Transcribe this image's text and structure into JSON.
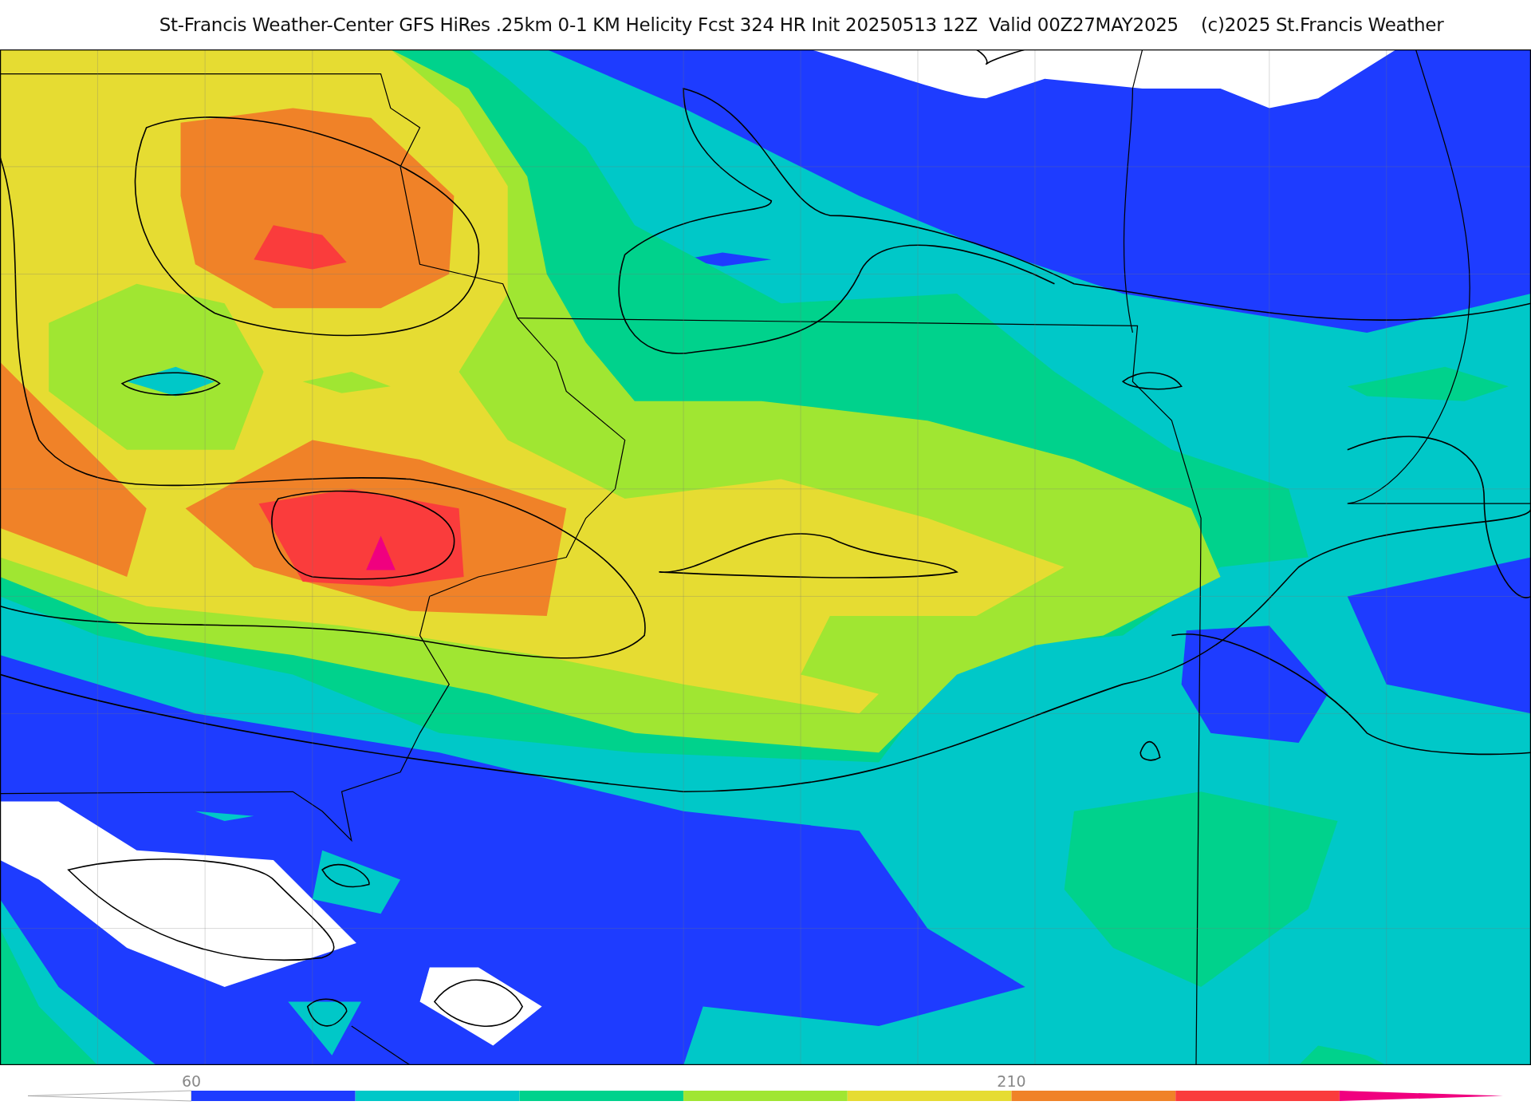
{
  "title": "St-Francis Weather-Center GFS HiRes .25km 0-1 KM Helicity Fcst 324 HR Init 20250513 12Z  Valid 00Z27MAY2025    (c)2025 St.Francis Weather",
  "colorbar": {
    "segments": [
      {
        "kind": "under",
        "color": "#ffffff"
      },
      {
        "kind": "bin",
        "color": "#1e3cff"
      },
      {
        "kind": "bin",
        "color": "#00c8c8"
      },
      {
        "kind": "bin",
        "color": "#00d28c"
      },
      {
        "kind": "bin",
        "color": "#a0e632"
      },
      {
        "kind": "bin",
        "color": "#e6dc32"
      },
      {
        "kind": "bin",
        "color": "#f08228"
      },
      {
        "kind": "bin",
        "color": "#fa3c3c"
      },
      {
        "kind": "over",
        "color": "#f0007f"
      }
    ],
    "ticks": [
      {
        "label": "60"
      },
      {
        "label": "210"
      }
    ]
  }
}
